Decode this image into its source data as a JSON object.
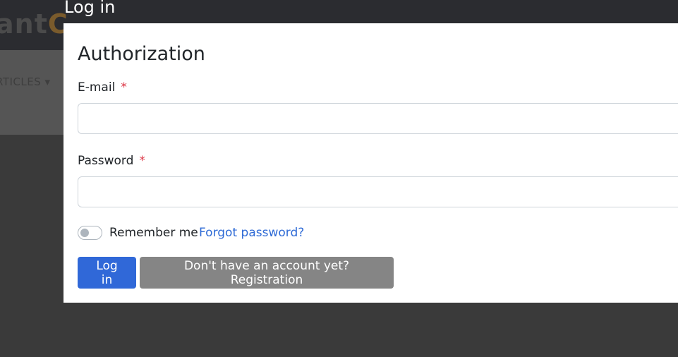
{
  "background": {
    "logo_text_main": "ant",
    "logo_text_accent": "C",
    "nav_item": "RTICLES ▾"
  },
  "modal": {
    "window_title": "Log in",
    "heading": "Authorization",
    "email_label": "E-mail",
    "password_label": "Password",
    "required_marker": "*",
    "email_value": "",
    "password_value": "",
    "remember_me_label": "Remember me",
    "remember_me_checked": false,
    "forgot_password_link": "Forgot password?",
    "login_button": "Log in",
    "register_button": "Don't have an account yet? Registration"
  },
  "colors": {
    "primary": "#3068d8",
    "secondary": "#858585",
    "link": "#2f6bd6",
    "required": "#dc3545"
  }
}
